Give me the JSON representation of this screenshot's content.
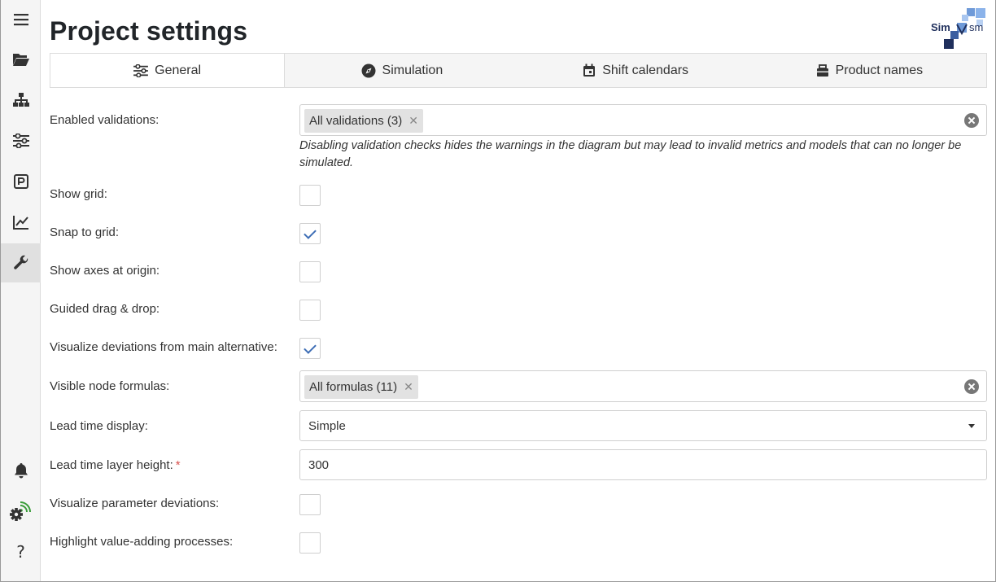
{
  "page": {
    "title": "Project settings"
  },
  "logo": {
    "text_left": "Sim",
    "text_right": "sm"
  },
  "sidebar": {
    "items": [
      {
        "icon": "hamburger-icon"
      },
      {
        "icon": "folder-open-icon"
      },
      {
        "icon": "sitemap-icon"
      },
      {
        "icon": "sliders-icon"
      },
      {
        "icon": "parking-p-icon",
        "glyph": "P"
      },
      {
        "icon": "line-chart-icon"
      },
      {
        "icon": "wrench-icon",
        "active": true
      },
      {
        "icon": "bell-icon"
      },
      {
        "icon": "gear-wifi-icon"
      },
      {
        "icon": "help-icon",
        "glyph": "?"
      }
    ]
  },
  "tabs": [
    {
      "label": "General",
      "icon": "sliders-icon",
      "active": true
    },
    {
      "label": "Simulation",
      "icon": "compass-icon"
    },
    {
      "label": "Shift calendars",
      "icon": "calendar-icon"
    },
    {
      "label": "Product names",
      "icon": "box-icon"
    }
  ],
  "form": {
    "enabled_validations": {
      "label": "Enabled validations:",
      "chip": "All validations (3)",
      "hint": "Disabling validation checks hides the warnings in the diagram but may lead to invalid metrics and models that can no longer be simulated."
    },
    "show_grid": {
      "label": "Show grid:",
      "checked": false
    },
    "snap_to_grid": {
      "label": "Snap to grid:",
      "checked": true
    },
    "show_axes": {
      "label": "Show axes at origin:",
      "checked": false
    },
    "guided_drag": {
      "label": "Guided drag & drop:",
      "checked": false
    },
    "visualize_deviations": {
      "label": "Visualize deviations from main alternative:",
      "checked": true
    },
    "visible_formulas": {
      "label": "Visible node formulas:",
      "chip": "All formulas (11)"
    },
    "lead_time_display": {
      "label": "Lead time display:",
      "value": "Simple"
    },
    "lead_time_layer_height": {
      "label": "Lead time layer height:",
      "required_mark": "*",
      "value": "300"
    },
    "visualize_param_deviations": {
      "label": "Visualize parameter deviations:",
      "checked": false
    },
    "highlight_value_adding": {
      "label": "Highlight value-adding processes:",
      "checked": false
    }
  },
  "colors": {
    "accent": "#3d6db5",
    "sidebar_bg": "#f5f5f5",
    "required": "#d9534f",
    "wifi_green": "#3a9d3a"
  }
}
